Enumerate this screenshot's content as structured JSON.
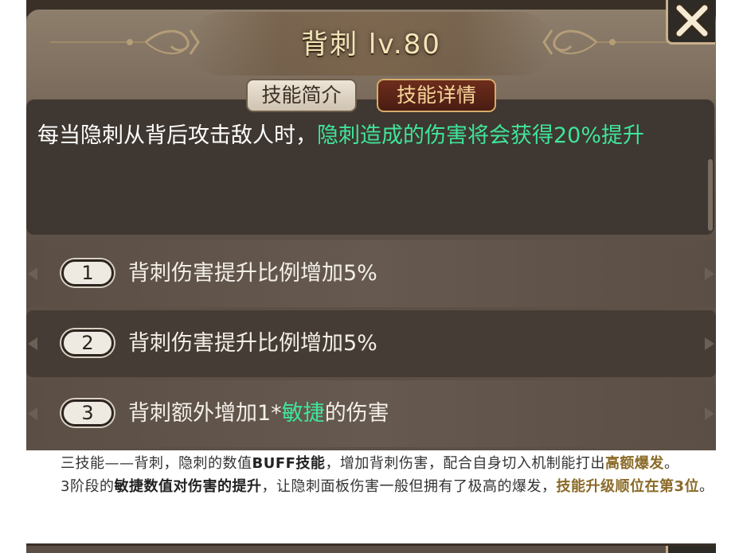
{
  "skill": {
    "title": "背刺 lv.80",
    "tabs": [
      {
        "label": "技能简介",
        "active": false
      },
      {
        "label": "技能详情",
        "active": true
      }
    ],
    "description_white": "每当隐刺从背后攻击敌人时，",
    "description_green": "隐刺造成的伤害将会获得20%提升",
    "levels": [
      {
        "num": "1",
        "text": "背刺伤害提升比例增加5%"
      },
      {
        "num": "2",
        "text": "背刺伤害提升比例增加5%"
      },
      {
        "num": "3",
        "text_pre": "背刺额外增加1*",
        "text_green": "敏捷",
        "text_post": "的伤害"
      }
    ],
    "close_icon": "close-x-icon"
  },
  "article": {
    "p1_a": "三技能——背刺，隐刺的数值",
    "p1_b": "BUFF技能",
    "p1_c": "，增加背刺伤害，配合自身切入机制能打出",
    "p1_d": "高额爆发",
    "p1_e": "。",
    "p2_a": "3阶段的",
    "p2_b": "敏捷数值对伤害的提升",
    "p2_c": "，让隐刺面板伤害一般但拥有了极高的爆发，",
    "p2_d": "技能升级顺位在第3位",
    "p2_e": "。"
  },
  "colors": {
    "panel": "#5b4f45",
    "desc_bg": "#3f3731",
    "green_text": "#3fe59a",
    "title_text": "#f4e4b8",
    "gold_bold": "#8a6a28"
  }
}
